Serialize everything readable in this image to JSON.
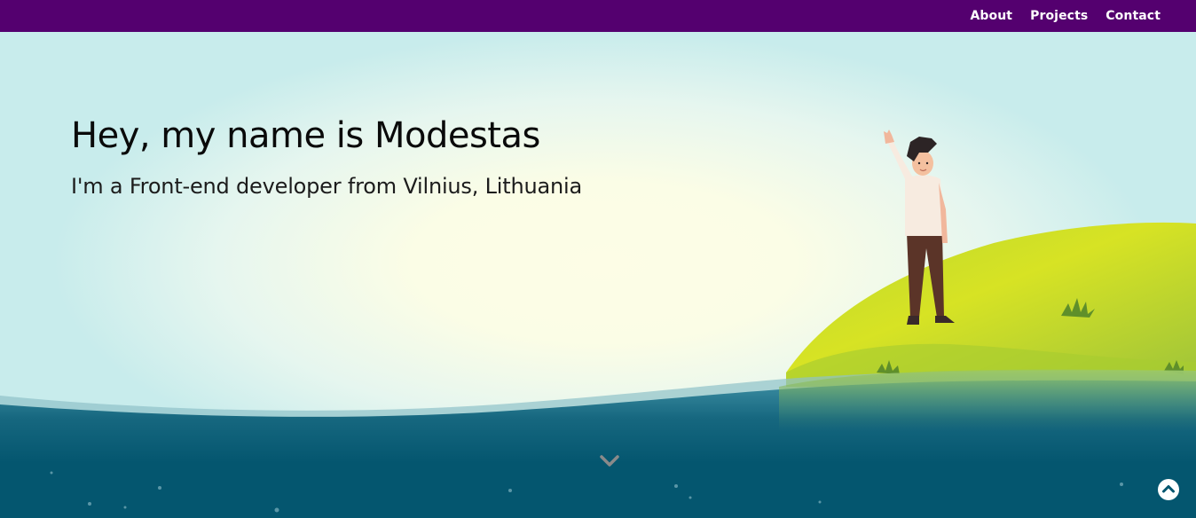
{
  "nav": {
    "about": "About",
    "projects": "Projects",
    "contact": "Contact"
  },
  "hero": {
    "title": "Hey, my name is Modestas",
    "subtitle": "I'm a Front-end developer from Vilnius, Lithuania"
  },
  "icons": {
    "scroll_down": "chevron-down-icon",
    "back_to_top": "arrow-up-circle-icon"
  },
  "colors": {
    "navbar": "#54006f",
    "water": "#04566f",
    "hill": "#a6c934",
    "sky": "#c8ecec"
  }
}
